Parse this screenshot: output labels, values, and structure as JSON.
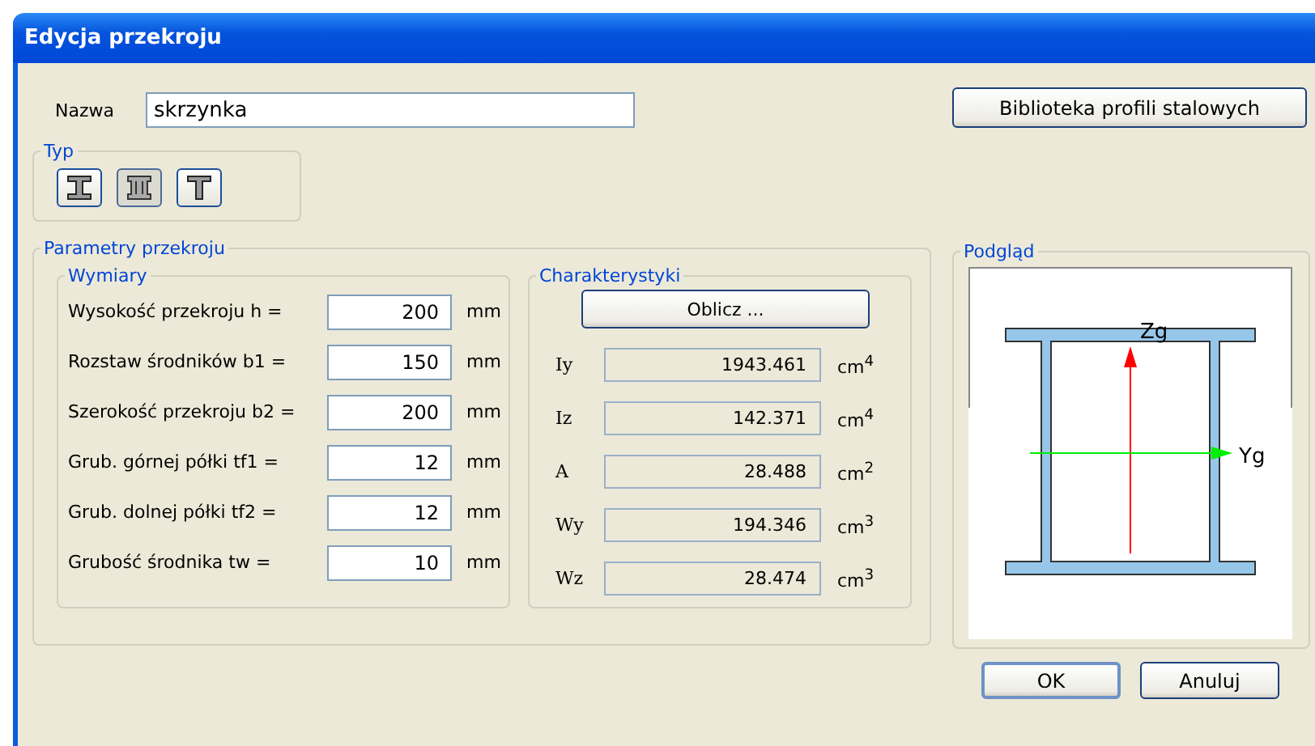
{
  "window": {
    "title": "Edycja przekroju"
  },
  "name_field": {
    "label": "Nazwa",
    "value": "skrzynka"
  },
  "library_button": "Biblioteka profili stalowych",
  "type_group": {
    "title": "Typ",
    "types": [
      {
        "kind": "i-beam",
        "selected": false
      },
      {
        "kind": "box",
        "selected": true
      },
      {
        "kind": "tee",
        "selected": false
      }
    ]
  },
  "parameters": {
    "title": "Parametry przekroju",
    "dimensions": {
      "title": "Wymiary",
      "rows": [
        {
          "label": "Wysokość przekroju h =",
          "value": "200",
          "unit": "mm"
        },
        {
          "label": "Rozstaw środników b1 =",
          "value": "150",
          "unit": "mm"
        },
        {
          "label": "Szerokość przekroju b2 =",
          "value": "200",
          "unit": "mm"
        },
        {
          "label": "Grub. górnej półki tf1 =",
          "value": "12",
          "unit": "mm"
        },
        {
          "label": "Grub. dolnej półki tf2 =",
          "value": "12",
          "unit": "mm"
        },
        {
          "label": "Grubość środnika tw =",
          "value": "10",
          "unit": "mm"
        }
      ]
    },
    "characteristics": {
      "title": "Charakterystyki",
      "button": "Oblicz ...",
      "rows": [
        {
          "label": "Iy",
          "value": "1943.461",
          "unit": "cm$^{4}$"
        },
        {
          "label": "Iz",
          "value": "142.371",
          "unit": "cm$^{4}$"
        },
        {
          "label": "A",
          "value": "28.488",
          "unit": "cm$^{2}$"
        },
        {
          "label": "Wy",
          "value": "194.346",
          "unit": "cm$^{3}$"
        },
        {
          "label": "Wz",
          "value": "28.474",
          "unit": "cm$^{3}$"
        }
      ]
    }
  },
  "preview": {
    "title": "Podgląd",
    "axis_z": "Zg",
    "axis_y": "Yg"
  },
  "buttons": [
    "OK",
    "Anuluj"
  ]
}
